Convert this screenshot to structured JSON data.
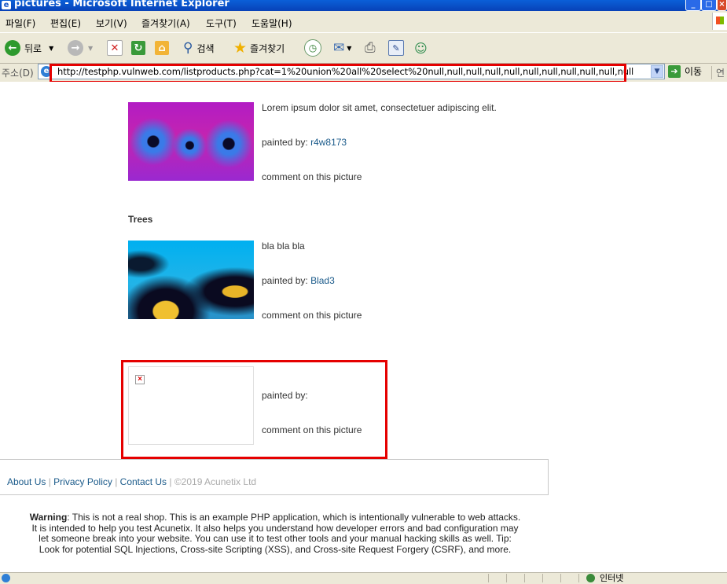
{
  "window": {
    "title": "pictures - Microsoft Internet Explorer"
  },
  "menu": [
    "파일(F)",
    "편집(E)",
    "보기(V)",
    "즐겨찾기(A)",
    "도구(T)",
    "도움말(H)"
  ],
  "toolbar": {
    "back_label": "뒤로",
    "search_label": "검색",
    "favorites_label": "즐겨찾기"
  },
  "address": {
    "label": "주소(D)",
    "url": "http://testphp.vulnweb.com/listproducts.php?cat=1%20union%20all%20select%20null,null,null,null,null,null,null,null,null,null,null",
    "go_label": "이동",
    "links_label": "연"
  },
  "products": [
    {
      "title": "",
      "description": "Lorem ipsum dolor sit amet, consectetuer adipiscing elit.",
      "painted_by_label": "painted by:",
      "artist": "r4w8173",
      "comment_link": "comment on this picture"
    },
    {
      "title": "Trees",
      "description": "bla bla bla",
      "painted_by_label": "painted by:",
      "artist": "Blad3",
      "comment_link": "comment on this picture"
    },
    {
      "title": "",
      "description": "",
      "painted_by_label": "painted by:",
      "artist": "",
      "comment_link": "comment on this picture"
    }
  ],
  "footer": {
    "about": "About Us",
    "privacy": "Privacy Policy",
    "contact": "Contact Us",
    "copyright": "©2019 Acunetix Ltd",
    "separator": "|"
  },
  "warning": {
    "label": "Warning",
    "text": ": This is not a real shop. This is an example PHP application, which is intentionally vulnerable to web attacks. It is intended to help you test Acunetix. It also helps you understand how developer errors and bad configuration may let someone break into your website. You can use it to test other tools and your manual hacking skills as well. Tip: Look for potential SQL Injections, Cross-site Scripting (XSS), and Cross-site Request Forgery (CSRF), and more."
  },
  "status": {
    "zone": "인터넷"
  },
  "colors": {
    "title_bar": "#0a5fd8",
    "link": "#1a5a8a",
    "highlight_box": "#e50000"
  }
}
